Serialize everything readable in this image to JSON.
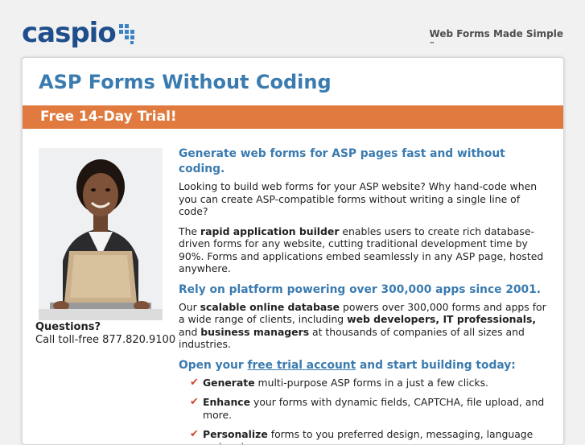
{
  "header": {
    "logo_text": "caspio",
    "tagline": "Web Forms Made Simple",
    "tagline_tm": "™"
  },
  "page": {
    "title": "ASP Forms Without Coding",
    "banner": "Free 14-Day Trial!"
  },
  "sidebar": {
    "questions_label": "Questions?",
    "phone_text": "Call toll-free 877.820.9100"
  },
  "main": {
    "heading1": "Generate web forms for ASP pages fast and without coding.",
    "para1": "Looking to build web forms for your ASP website? Why hand-code when you can create ASP-compatible forms without writing a single line of code?",
    "para2_pre": "The ",
    "para2_bold": "rapid application builder",
    "para2_post": " enables users to create rich database-driven forms for any website, cutting traditional development time by 90%. Forms and applications embed seamlessly in any ASP page, hosted anywhere.",
    "heading2": "Rely on platform powering over 300,000 apps since 2001.",
    "para3_pre": "Our ",
    "para3_b1": "scalable online database",
    "para3_mid1": " powers over 300,000 forms and apps for a wide range of clients, including ",
    "para3_b2": "web developers, IT professionals,",
    "para3_mid2": " and ",
    "para3_b3": "business managers",
    "para3_post": " at thousands of companies of all sizes and industries.",
    "heading3_pre": "Open your ",
    "heading3_link": "free trial account",
    "heading3_post": " and start building today:",
    "bullets": [
      {
        "bold": "Generate",
        "text": " multi-purpose ASP forms in a just a few clicks."
      },
      {
        "bold": "Enhance",
        "text": " your forms with dynamic fields, CAPTCHA, file upload, and more."
      },
      {
        "bold": "Personalize",
        "text": " forms to you preferred design, messaging, language and region."
      }
    ]
  },
  "icons": {
    "bullet_icon": "check-icon",
    "check_color": "#d24a2c"
  },
  "colors": {
    "accent_blue": "#3a7bb0",
    "banner_orange": "#e07a3f",
    "logo_blue": "#1f4e8c"
  }
}
